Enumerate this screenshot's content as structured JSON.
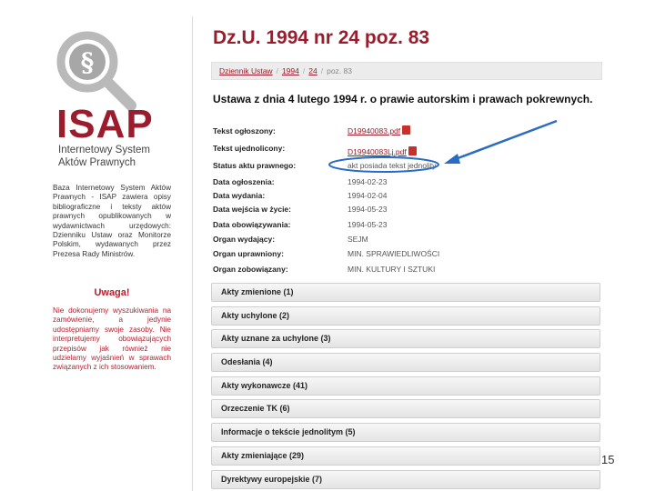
{
  "sidebar": {
    "logo_symbol": "§",
    "logo_text": "ISAP",
    "logo_subtitle": "Internetowy System Aktów Prawnych",
    "intro": "Baza Internetowy System Aktów Prawnych - ISAP zawiera opisy bibliograficzne i teksty aktów prawnych opublikowanych w wydawnictwach urzędowych: Dzienniku Ustaw oraz Monitorze Polskim, wydawanych przez Prezesa Rady Ministrów.",
    "warning_title": "Uwaga!",
    "warning_text": "Nie dokonujemy wyszukiwania na zamówienie, a jedynie udostępniamy swoje zasoby. Nie interpretujemy obowiązujących przepisów jak również nie udzielamy wyjaśnień w sprawach związanych z ich stosowaniem."
  },
  "main": {
    "title": "Dz.U. 1994 nr 24 poz. 83",
    "breadcrumb": {
      "journal": "Dziennik Ustaw",
      "year": "1994",
      "number": "24",
      "position": "poz. 83"
    },
    "act_title": "Ustawa z dnia 4 lutego 1994 r. o prawie autorskim i prawach pokrewnych.",
    "meta": {
      "published_text_label": "Tekst ogłoszony:",
      "published_text_value": "D19940083.pdf",
      "consolidated_text_label": "Tekst ujednolicony:",
      "consolidated_text_value": "D19940083Lj.pdf",
      "status_label": "Status aktu prawnego:",
      "status_value": "akt posiada tekst jednolity",
      "announce_date_label": "Data ogłoszenia:",
      "announce_date_value": "1994-02-23",
      "issue_date_label": "Data wydania:",
      "issue_date_value": "1994-02-04",
      "entry_date_label": "Data wejścia w życie:",
      "entry_date_value": "1994-05-23",
      "effective_date_label": "Data obowiązywania:",
      "effective_date_value": "1994-05-23",
      "issuer_label": "Organ wydający:",
      "issuer_value": "SEJM",
      "authorized_label": "Organ uprawniony:",
      "authorized_value": "MIN. SPRAWIEDLIWOŚCI",
      "obligated_label": "Organ zobowiązany:",
      "obligated_value": "MIN. KULTURY I SZTUKI"
    },
    "sections": [
      "Akty zmienione (1)",
      "Akty uchylone (2)",
      "Akty uznane za uchylone (3)",
      "Odesłania (4)",
      "Akty wykonawcze (41)",
      "Orzeczenie TK (6)",
      "Informacje o tekście jednolitym (5)",
      "Akty zmieniające (29)",
      "Dyrektywy europejskie (7)"
    ]
  },
  "page_number": "15",
  "colors": {
    "brand": "#9b1c2c",
    "warning": "#b3212e",
    "annotation": "#2a6bc5"
  }
}
